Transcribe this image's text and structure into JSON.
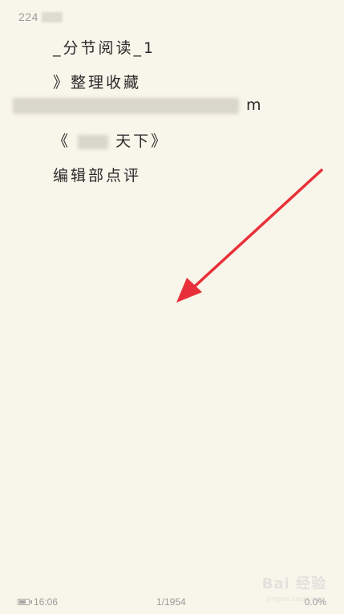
{
  "header": {
    "chapter_number": "224"
  },
  "content": {
    "lines": [
      "_分节阅读_1",
      "》整理收藏",
      "m",
      "《",
      "天下》",
      "编辑部点评"
    ]
  },
  "status": {
    "battery_level": 0.7,
    "time": "16:06",
    "page": "1/1954",
    "progress": "0.0%"
  },
  "watermark": {
    "logo_text": "Bai 经验",
    "sub_text": "jingyan.baidu.com"
  },
  "colors": {
    "background": "#f8f5ea",
    "text": "#2a2a2a",
    "muted": "#9a9a9a",
    "arrow": "#e8303a"
  }
}
